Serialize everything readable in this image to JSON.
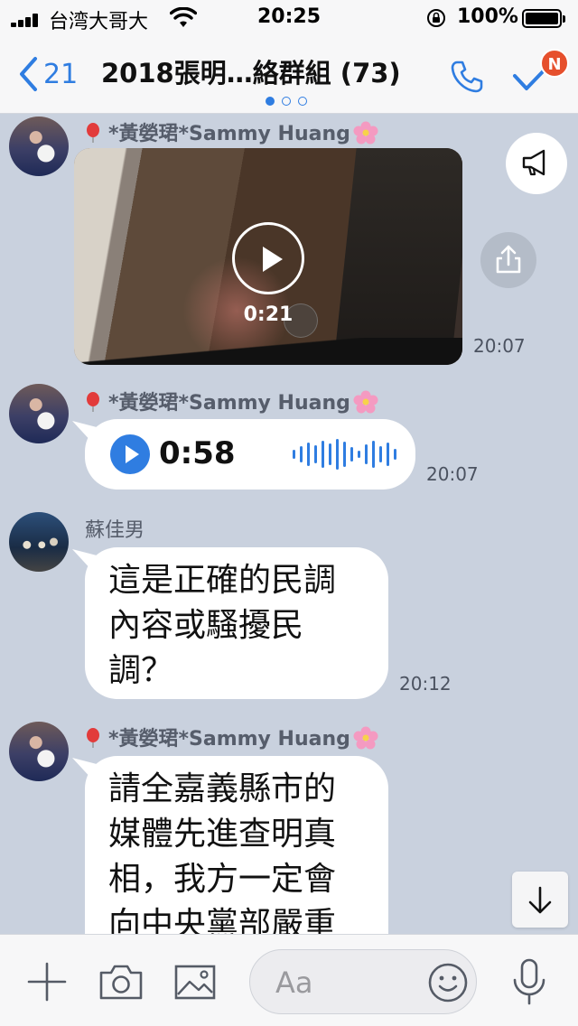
{
  "status_bar": {
    "carrier": "台湾大哥大",
    "time": "20:25",
    "battery": "100%"
  },
  "nav": {
    "back_count": "21",
    "title": "2018張明…絡群組 (73)",
    "badge": "N",
    "page_indicator": {
      "count": 3,
      "active": 0
    }
  },
  "messages": [
    {
      "sender": "*黃嫈珺*Sammy Huang",
      "type": "video",
      "duration": "0:21",
      "time": "20:07"
    },
    {
      "sender": "*黃嫈珺*Sammy Huang",
      "type": "audio",
      "duration": "0:58",
      "time": "20:07"
    },
    {
      "sender": "蘇佳男",
      "type": "text",
      "lines": [
        "這是正確的民調",
        "內容或騷擾民",
        "調？"
      ],
      "time": "20:12"
    },
    {
      "sender": "*黃嫈珺*Sammy Huang",
      "type": "text",
      "lines": [
        "請全嘉義縣市的",
        "媒體先進查明真",
        "相，我方一定會",
        "向中央黨部嚴重"
      ]
    }
  ],
  "input": {
    "placeholder": "Aa"
  },
  "icons": {
    "nav": [
      "chevron-left-icon",
      "phone-icon",
      "check-icon"
    ],
    "chat": [
      "megaphone-icon",
      "share-icon",
      "chevron-down-icon"
    ],
    "input_bar": [
      "plus-icon",
      "camera-icon",
      "image-icon",
      "emoji-icon",
      "microphone-icon"
    ]
  },
  "colors": {
    "accent": "#2f7de1",
    "chat_background": "#c9d1de",
    "badge": "#e6502d"
  }
}
